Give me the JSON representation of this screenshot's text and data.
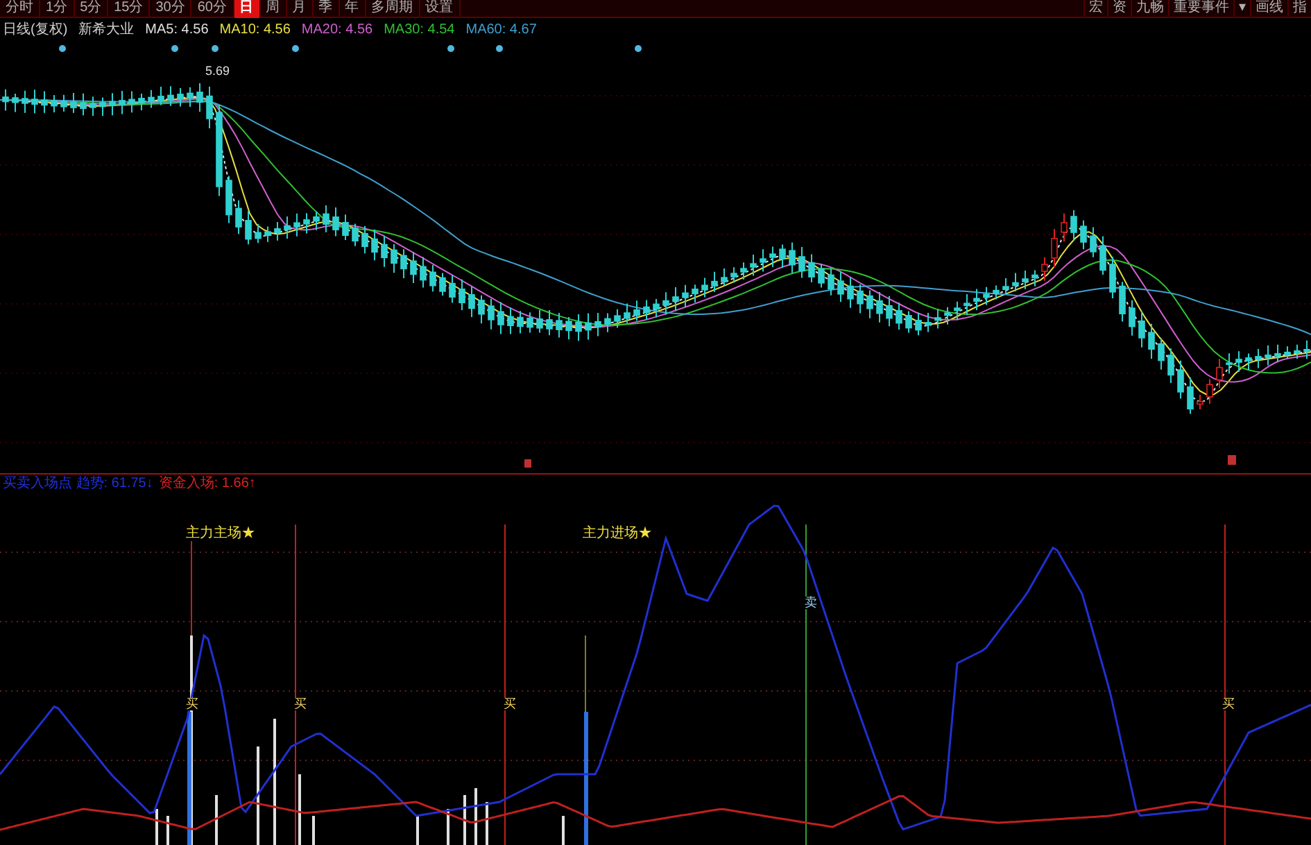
{
  "toolbar": {
    "periods": [
      {
        "label": "分时",
        "selected": false
      },
      {
        "label": "1分",
        "selected": false
      },
      {
        "label": "5分",
        "selected": false
      },
      {
        "label": "15分",
        "selected": false
      },
      {
        "label": "30分",
        "selected": false
      },
      {
        "label": "60分",
        "selected": false
      },
      {
        "label": "日",
        "selected": true
      },
      {
        "label": "周",
        "selected": false
      },
      {
        "label": "月",
        "selected": false
      },
      {
        "label": "季",
        "selected": false
      },
      {
        "label": "年",
        "selected": false
      },
      {
        "label": "多周期",
        "selected": false
      },
      {
        "label": "设置",
        "selected": false
      }
    ],
    "tools": [
      "宏",
      "资",
      "九畅",
      "重要事件",
      "▾",
      "画线",
      "指"
    ]
  },
  "main_legend": {
    "period": "日线(复权)",
    "name": "新希大业",
    "averages": [
      {
        "label": "MA5: 4.56",
        "color": "#e0e0e0"
      },
      {
        "label": "MA10: 4.56",
        "color": "#e8e040"
      },
      {
        "label": "MA20: 4.56",
        "color": "#d060d0"
      },
      {
        "label": "MA30: 4.54",
        "color": "#30c030"
      },
      {
        "label": "MA60: 4.67",
        "color": "#40a0d0"
      }
    ]
  },
  "price_label": "5.69",
  "indicator_legend": [
    {
      "label": "买卖入场点 趋势: 61.75↓",
      "color": "#2030e0"
    },
    {
      "label": "资金入场: 1.66↑",
      "color": "#e02020"
    }
  ],
  "annotations": [
    "主力主场★",
    "主力进场★"
  ],
  "signals": [
    {
      "kind": "buy",
      "text": "买"
    },
    {
      "kind": "buy",
      "text": "买"
    },
    {
      "kind": "buy",
      "text": "买"
    },
    {
      "kind": "sell",
      "text": "卖"
    },
    {
      "kind": "buy",
      "text": "买"
    }
  ]
}
